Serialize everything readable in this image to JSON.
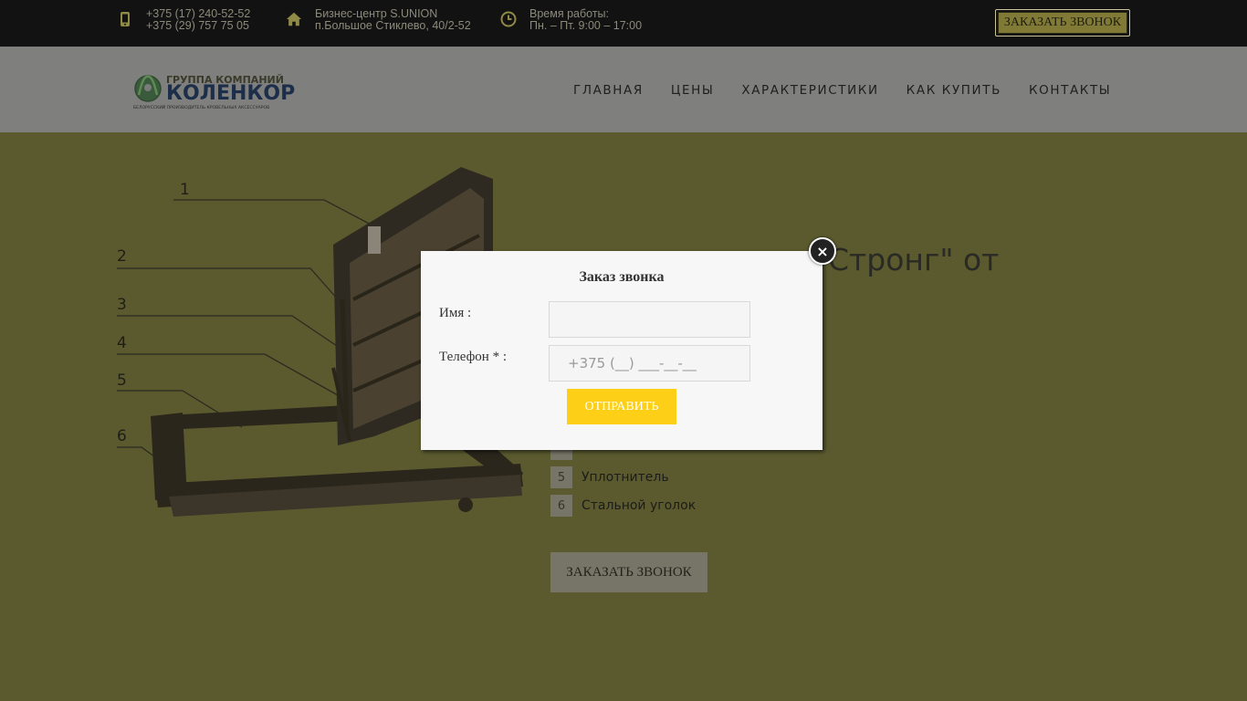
{
  "topbar": {
    "phone1": "+375 (17) 240-52-52",
    "phone2": "+375 (29) 757 75 05",
    "address_line1": "Бизнес-центр S.UNION",
    "address_line2": "п.Большое Стиклево, 40/2-52",
    "hours_label": "Время работы:",
    "hours_value": "Пн. – Пт. 9:00 – 17:00",
    "callback_button": "ЗАКАЗАТЬ ЗВОНОК",
    "icons": [
      "phone-icon",
      "home-icon",
      "clock-icon"
    ]
  },
  "header": {
    "logo_line1": "ГРУППА КОМПАНИЙ",
    "logo_line2": "КОЛЕНКОР",
    "logo_line3": "БЕЛОРУССКИЙ ПРОИЗВОДИТЕЛЬ КРОВЕЛЬНЫХ АКСЕССУАРОВ",
    "nav": [
      "ГЛАВНАЯ",
      "ЦЕНЫ",
      "ХАРАКТЕРИСТИКИ",
      "КАК КУПИТЬ",
      "КОНТАКТЫ"
    ]
  },
  "main": {
    "title_visible": "Стронг\" от",
    "diagram_labels": [
      "1",
      "2",
      "3",
      "4",
      "5",
      "6"
    ],
    "legend": [
      {
        "num": "5",
        "label": "Уплотнитель"
      },
      {
        "num": "6",
        "label": "Стальной уголок"
      }
    ],
    "callback_button": "ЗАКАЗАТЬ ЗВОНОК"
  },
  "modal": {
    "title": "Заказ звонка",
    "name_label": "Имя :",
    "name_value": "",
    "phone_label": "Телефон * :",
    "phone_placeholder": "+375 (__) ___-__-__",
    "submit_label": "ОТПРАВИТЬ",
    "close_glyph": "×"
  },
  "colors": {
    "topbar_bg": "#121212",
    "header_bg": "#7f7f7d",
    "main_bg": "#5b5a2f",
    "accent_yellow": "#fdd017",
    "modal_bg": "#f7f7f8"
  }
}
